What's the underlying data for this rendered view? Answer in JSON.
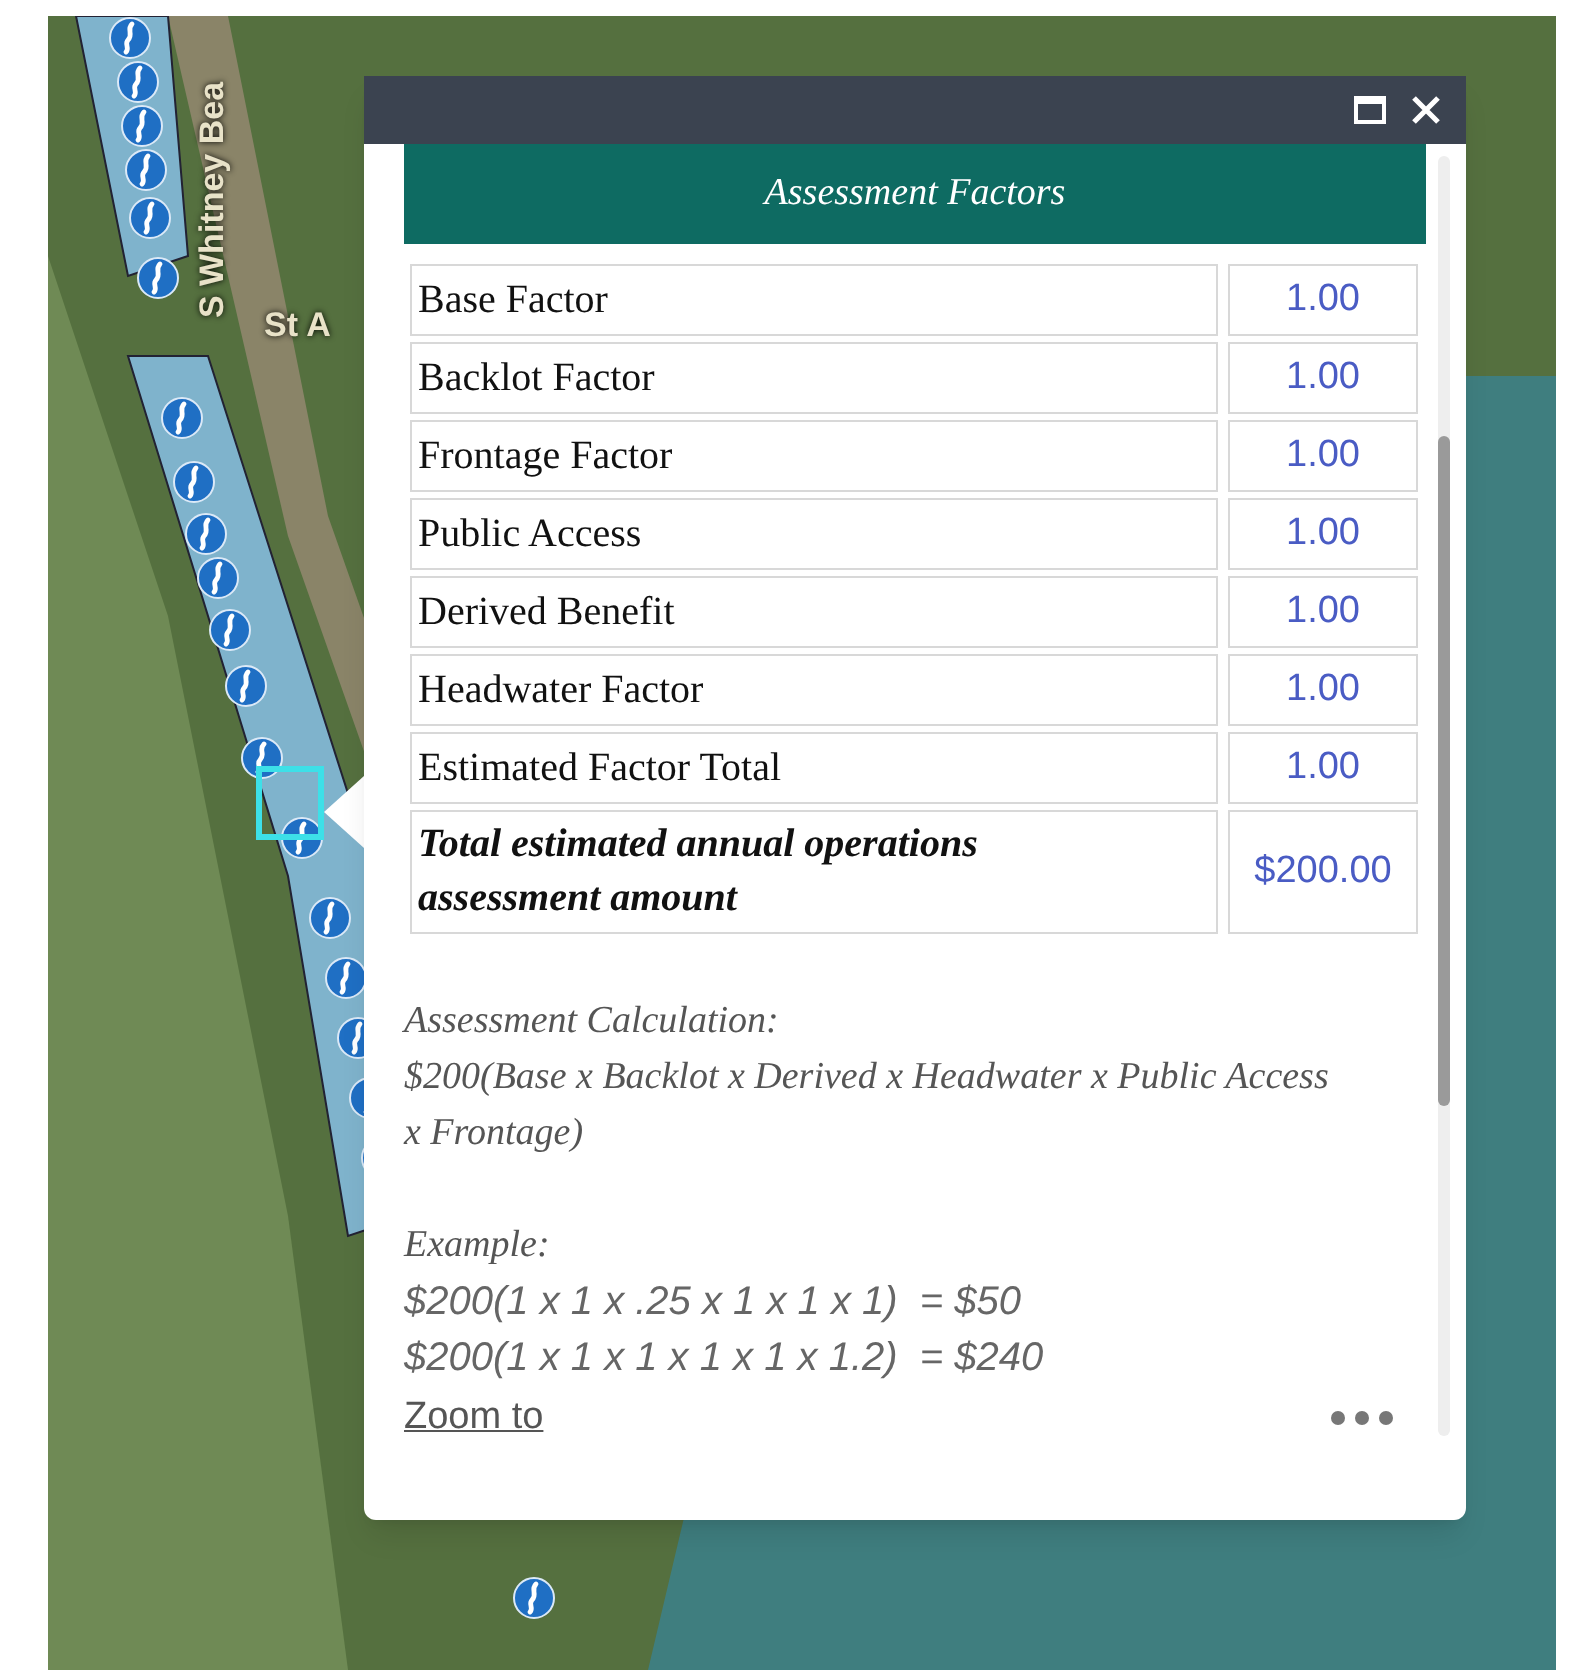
{
  "map": {
    "labels": [
      {
        "text": "S Whitney Bea",
        "kind": "road"
      },
      {
        "text": "St A",
        "kind": "place"
      }
    ]
  },
  "popup": {
    "title": "Assessment Factors",
    "rows": [
      {
        "label": "Base Factor",
        "value": "1.00",
        "kind": "factor"
      },
      {
        "label": "Backlot Factor",
        "value": "1.00",
        "kind": "factor"
      },
      {
        "label": "Frontage Factor",
        "value": "1.00",
        "kind": "factor"
      },
      {
        "label": "Public Access",
        "value": "1.00",
        "kind": "factor"
      },
      {
        "label": "Derived Benefit",
        "value": "1.00",
        "kind": "factor"
      },
      {
        "label": "Headwater Factor",
        "value": "1.00",
        "kind": "factor"
      },
      {
        "label": "Estimated Factor Total",
        "value": "1.00",
        "kind": "factor"
      },
      {
        "label": "Total estimated annual operations assessment amount",
        "value": "$200.00",
        "kind": "total"
      }
    ],
    "calculation": {
      "heading": "Assessment Calculation:",
      "formula": "$200(Base x Backlot x Derived x Headwater x Public Access x Frontage)"
    },
    "example": {
      "heading": "Example:",
      "lines": [
        "$200(1 x 1 x .25 x 1 x 1 x 1)  = $50",
        "$200(1 x 1 x 1 x 1 x 1 x 1.2)  = $240"
      ]
    },
    "zoom_link": "Zoom to"
  }
}
